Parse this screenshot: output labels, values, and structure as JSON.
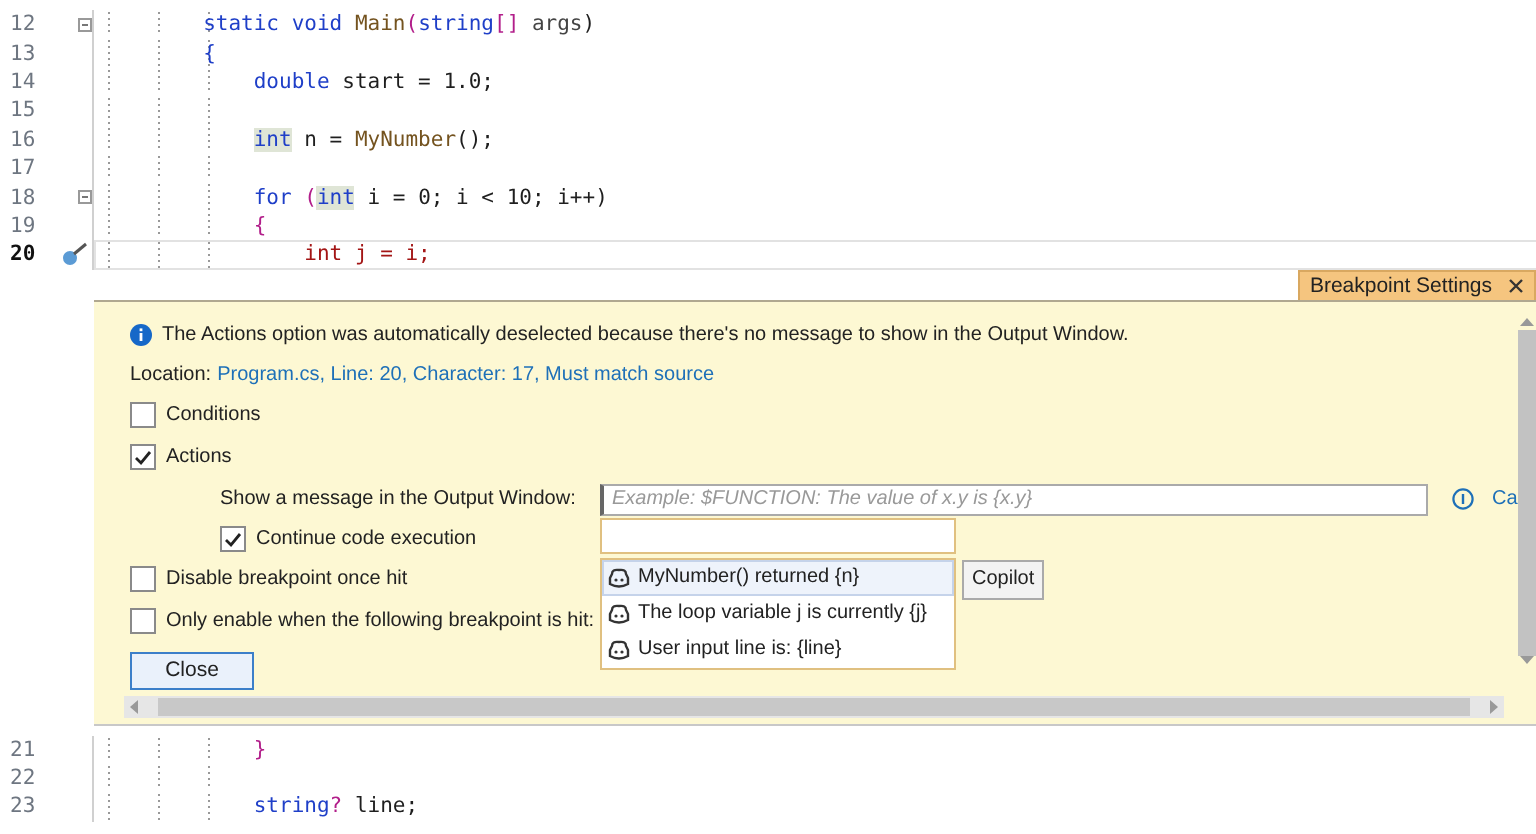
{
  "code_top": {
    "lines": [
      {
        "number": "12",
        "fold": true,
        "breakpoint": false,
        "current": false,
        "tokens": [
          {
            "text": "        static void ",
            "kind": "keyword"
          },
          {
            "text": "Main",
            "kind": "method"
          },
          {
            "text": "(",
            "kind": "bracket"
          },
          {
            "text": "string",
            "kind": "keyword"
          },
          {
            "text": "[] ",
            "kind": "bracket"
          },
          {
            "text": "args",
            "kind": "param"
          },
          {
            "text": ")",
            "kind": "plain"
          }
        ]
      },
      {
        "number": "13",
        "fold": false,
        "breakpoint": false,
        "current": false,
        "tokens": [
          {
            "text": "        {",
            "kind": "keyword"
          }
        ]
      },
      {
        "number": "14",
        "fold": false,
        "breakpoint": false,
        "current": false,
        "tokens": [
          {
            "text": "            double ",
            "kind": "keyword"
          },
          {
            "text": "start = 1.0;",
            "kind": "plain"
          }
        ]
      },
      {
        "number": "15",
        "fold": false,
        "breakpoint": false,
        "current": false
      },
      {
        "number": "16",
        "fold": false,
        "breakpoint": false,
        "current": false,
        "tokens": [
          {
            "text": "            int",
            "kind": "reference"
          },
          {
            "text": " n = ",
            "kind": "plain"
          },
          {
            "text": "MyNumber",
            "kind": "method"
          },
          {
            "text": "();",
            "kind": "plain"
          }
        ]
      },
      {
        "number": "17",
        "fold": false,
        "breakpoint": false,
        "current": false
      },
      {
        "number": "18",
        "fold": true,
        "breakpoint": false,
        "current": false,
        "tokens": [
          {
            "text": "            for ",
            "kind": "keyword"
          },
          {
            "text": "(",
            "kind": "bracket"
          },
          {
            "text": "int",
            "kind": "reference"
          },
          {
            "text": " i = 0; i < 10; i++)",
            "kind": "plain"
          }
        ]
      },
      {
        "number": "19",
        "fold": false,
        "breakpoint": false,
        "current": false,
        "tokens": [
          {
            "text": "            {",
            "kind": "bracket"
          }
        ]
      },
      {
        "number": "20",
        "fold": false,
        "breakpoint": true,
        "current": true,
        "tokens": [
          {
            "text": "                int j = i;",
            "kind": "red"
          }
        ]
      }
    ]
  },
  "breakpoint_settings": {
    "title": "Breakpoint Settings",
    "info_message": "The Actions option was automatically deselected because there's no message to show in the Output Window.",
    "location_label": "Location:",
    "location_link": "Program.cs, Line: 20, Character: 17, Must match source",
    "options": [
      {
        "label": "Conditions",
        "checked": false
      },
      {
        "label": "Actions",
        "checked": true
      }
    ],
    "actions": {
      "message_label": "Show a message in the Output Window:",
      "placeholder": "Example: $FUNCTION: The value of x.y is {x.y}",
      "trailing_text": "Ca",
      "continue": {
        "label": "Continue code execution",
        "checked": true
      },
      "suggestions": [
        {
          "text": "MyNumber() returned {n}",
          "selected": true
        },
        {
          "text": "The loop variable j is currently {j}",
          "selected": false
        },
        {
          "text": "User input line is: {line}",
          "selected": false
        }
      ],
      "suggestion_tooltip": "Copilot"
    },
    "options_after": [
      {
        "label": "Disable breakpoint once hit",
        "checked": false
      },
      {
        "label": "Only enable when the following breakpoint is hit:",
        "checked": false
      }
    ],
    "close_button": "Close"
  },
  "code_bottom": {
    "lines": [
      {
        "number": "21",
        "fold": false,
        "breakpoint": false,
        "current": false,
        "tokens": [
          {
            "text": "            }",
            "kind": "bracket"
          }
        ]
      },
      {
        "number": "22",
        "fold": false,
        "breakpoint": false,
        "current": false
      },
      {
        "number": "23",
        "fold": false,
        "breakpoint": false,
        "current": false,
        "tokens": [
          {
            "text": "            string",
            "kind": "keyword"
          },
          {
            "text": "?",
            "kind": "bracket"
          },
          {
            "text": " line;",
            "kind": "plain"
          }
        ]
      }
    ]
  }
}
